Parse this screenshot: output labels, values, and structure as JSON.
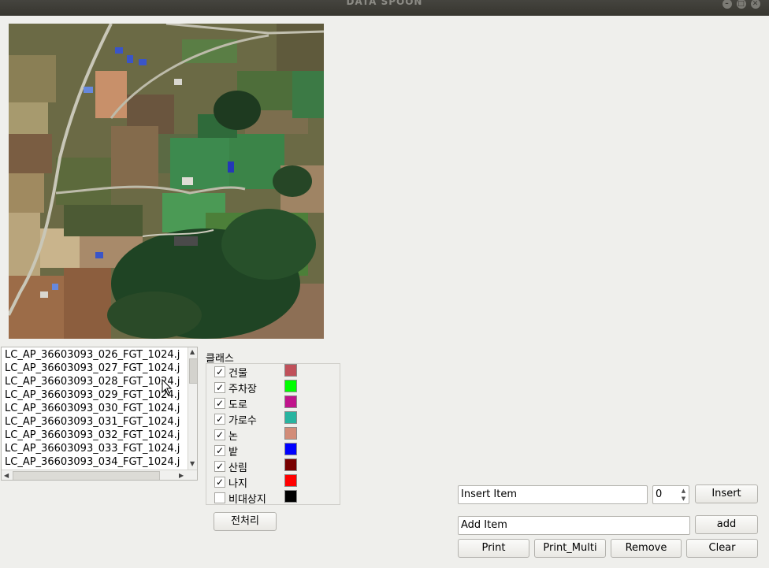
{
  "window": {
    "title": "DATA SPOON"
  },
  "files": [
    "LC_AP_36603093_026_FGT_1024.j",
    "LC_AP_36603093_027_FGT_1024.j",
    "LC_AP_36603093_028_FGT_1024.j",
    "LC_AP_36603093_029_FGT_1024.j",
    "LC_AP_36603093_030_FGT_1024.j",
    "LC_AP_36603093_031_FGT_1024.j",
    "LC_AP_36603093_032_FGT_1024.j",
    "LC_AP_36603093_033_FGT_1024.j",
    "LC_AP_36603093_034_FGT_1024.j"
  ],
  "classes": {
    "label": "클래스",
    "items": [
      {
        "name": "건물",
        "checked": true,
        "color": "#c0505a"
      },
      {
        "name": "주차장",
        "checked": true,
        "color": "#00ff00"
      },
      {
        "name": "도로",
        "checked": true,
        "color": "#c0148c"
      },
      {
        "name": "가로수",
        "checked": true,
        "color": "#28b4a0"
      },
      {
        "name": "논",
        "checked": true,
        "color": "#d28c78"
      },
      {
        "name": "밭",
        "checked": true,
        "color": "#0000ff"
      },
      {
        "name": "산림",
        "checked": true,
        "color": "#780000"
      },
      {
        "name": "나지",
        "checked": true,
        "color": "#ff0000"
      },
      {
        "name": "비대상지",
        "checked": false,
        "color": "#000000"
      }
    ]
  },
  "buttons": {
    "preprocess": "전처리",
    "insert": "Insert",
    "add": "add",
    "print": "Print",
    "print_multi": "Print_Multi",
    "remove": "Remove",
    "clear": "Clear"
  },
  "inputs": {
    "insert_item": "Insert Item",
    "insert_index": "0",
    "add_item": "Add Item"
  }
}
